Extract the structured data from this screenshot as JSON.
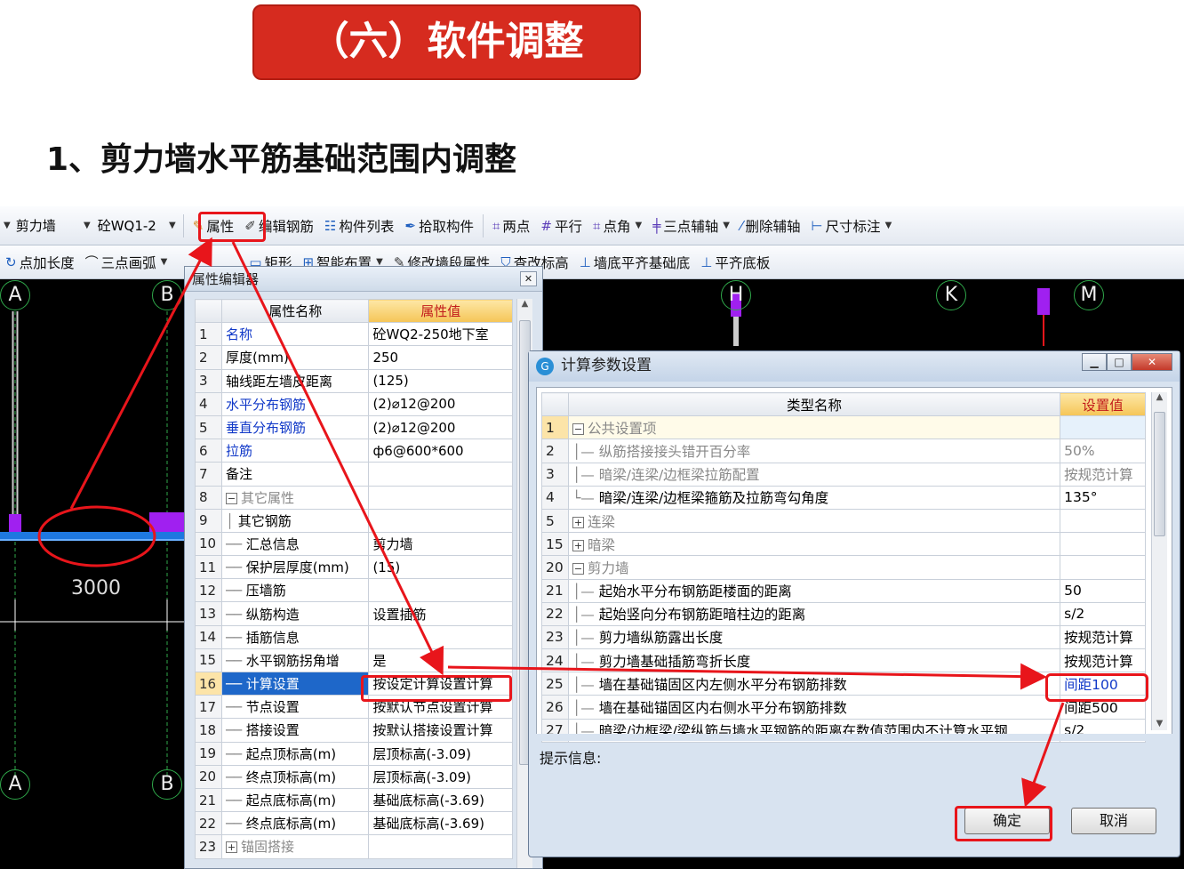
{
  "slide": {
    "title": "（六）软件调整",
    "subtitle": "1、剪力墙水平筋基础范围内调整"
  },
  "colors": {
    "accent_red": "#e8151b",
    "title_bg": "#d62b1f",
    "selection_blue": "#1e67c9",
    "header_gold": "#f5c557"
  },
  "toolbar1": {
    "combo_type": "剪力墙",
    "combo_component": "砼WQ1-2",
    "items": [
      {
        "icon": "properties-icon",
        "label": "属性"
      },
      {
        "icon": "edit-rebar-icon",
        "label": "编辑钢筋"
      },
      {
        "icon": "component-list-icon",
        "label": "构件列表"
      },
      {
        "icon": "pick-component-icon",
        "label": "拾取构件"
      },
      {
        "icon": "two-point-icon",
        "label": "两点"
      },
      {
        "icon": "parallel-icon",
        "label": "平行"
      },
      {
        "icon": "point-angle-icon",
        "label": "点角"
      },
      {
        "icon": "three-point-axis-icon",
        "label": "三点辅轴"
      },
      {
        "icon": "delete-axis-icon",
        "label": "删除辅轴"
      },
      {
        "icon": "dimension-icon",
        "label": "尺寸标注"
      }
    ]
  },
  "toolbar2": {
    "items": [
      {
        "icon": "point-length-icon",
        "label": "点加长度"
      },
      {
        "icon": "three-point-arc-icon",
        "label": "三点画弧"
      },
      {
        "icon": "rectangle-icon",
        "label": "矩形"
      },
      {
        "icon": "smart-layout-icon",
        "label": "智能布置"
      },
      {
        "icon": "modify-wall-icon",
        "label": "修改墙段属性"
      },
      {
        "icon": "check-elevation-icon",
        "label": "查改标高"
      },
      {
        "icon": "wall-bottom-align-icon",
        "label": "墙底平齐基础底"
      },
      {
        "icon": "align-bottom-icon",
        "label": "平齐底板"
      }
    ]
  },
  "canvas": {
    "axes_top": [
      "A",
      "B",
      "H",
      "K",
      "M"
    ],
    "axes_bottom": [
      "A",
      "B"
    ],
    "dimension": "3000"
  },
  "property_editor": {
    "title": "属性编辑器",
    "headers": [
      "属性名称",
      "属性值"
    ],
    "rows": [
      {
        "n": "1",
        "name": "名称",
        "value": "砼WQ2-250地下室"
      },
      {
        "n": "2",
        "name": "厚度(mm)",
        "value": "250"
      },
      {
        "n": "3",
        "name": "轴线距左墙皮距离",
        "value": "(125)"
      },
      {
        "n": "4",
        "name": "水平分布钢筋",
        "value": "(2)⌀12@200"
      },
      {
        "n": "5",
        "name": "垂直分布钢筋",
        "value": "(2)⌀12@200"
      },
      {
        "n": "6",
        "name": "拉筋",
        "value": "ф6@600*600"
      },
      {
        "n": "7",
        "name": "备注",
        "value": ""
      },
      {
        "n": "8",
        "name": "其它属性",
        "value": ""
      },
      {
        "n": "9",
        "name": "其它钢筋",
        "value": ""
      },
      {
        "n": "10",
        "name": "汇总信息",
        "value": "剪力墙"
      },
      {
        "n": "11",
        "name": "保护层厚度(mm)",
        "value": "(15)"
      },
      {
        "n": "12",
        "name": "压墙筋",
        "value": ""
      },
      {
        "n": "13",
        "name": "纵筋构造",
        "value": "设置插筋"
      },
      {
        "n": "14",
        "name": "插筋信息",
        "value": ""
      },
      {
        "n": "15",
        "name": "水平钢筋拐角增",
        "value": "是"
      },
      {
        "n": "16",
        "name": "计算设置",
        "value": "按设定计算设置计算"
      },
      {
        "n": "17",
        "name": "节点设置",
        "value": "按默认节点设置计算"
      },
      {
        "n": "18",
        "name": "搭接设置",
        "value": "按默认搭接设置计算"
      },
      {
        "n": "19",
        "name": "起点顶标高(m)",
        "value": "层顶标高(-3.09)"
      },
      {
        "n": "20",
        "name": "终点顶标高(m)",
        "value": "层顶标高(-3.09)"
      },
      {
        "n": "21",
        "name": "起点底标高(m)",
        "value": "基础底标高(-3.69)"
      },
      {
        "n": "22",
        "name": "终点底标高(m)",
        "value": "基础底标高(-3.69)"
      },
      {
        "n": "23",
        "name": "锚固搭接",
        "value": ""
      }
    ]
  },
  "calc_settings": {
    "title": "计算参数设置",
    "headers": [
      "类型名称",
      "设置值"
    ],
    "rows": [
      {
        "n": "1",
        "name": "公共设置项",
        "value": ""
      },
      {
        "n": "2",
        "name": "纵筋搭接接头错开百分率",
        "value": "50%"
      },
      {
        "n": "3",
        "name": "暗梁/连梁/边框梁拉筋配置",
        "value": "按规范计算"
      },
      {
        "n": "4",
        "name": "暗梁/连梁/边框梁箍筋及拉筋弯勾角度",
        "value": "135°"
      },
      {
        "n": "5",
        "name": "连梁",
        "value": ""
      },
      {
        "n": "15",
        "name": "暗梁",
        "value": ""
      },
      {
        "n": "20",
        "name": "剪力墙",
        "value": ""
      },
      {
        "n": "21",
        "name": "起始水平分布钢筋距楼面的距离",
        "value": "50"
      },
      {
        "n": "22",
        "name": "起始竖向分布钢筋距暗柱边的距离",
        "value": "s/2"
      },
      {
        "n": "23",
        "name": "剪力墙纵筋露出长度",
        "value": "按规范计算"
      },
      {
        "n": "24",
        "name": "剪力墙基础插筋弯折长度",
        "value": "按规范计算"
      },
      {
        "n": "25",
        "name": "墙在基础锚固区内左侧水平分布钢筋排数",
        "value": "间距100"
      },
      {
        "n": "26",
        "name": "墙在基础锚固区内右侧水平分布钢筋排数",
        "value": "间距500"
      },
      {
        "n": "27",
        "name": "暗梁/边框梁/梁纵筋与墙水平钢筋的距离在数值范围内不计算水平钢",
        "value": "s/2"
      }
    ],
    "hint_label": "提示信息:",
    "ok_label": "确定",
    "cancel_label": "取消"
  }
}
